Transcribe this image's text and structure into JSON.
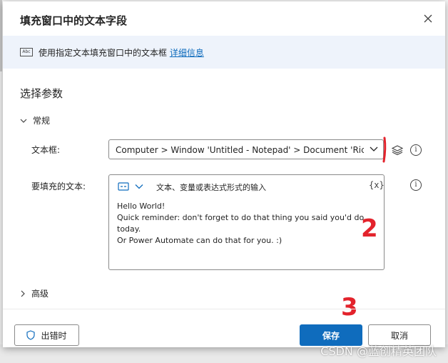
{
  "dialog": {
    "title": "填充窗口中的文本字段",
    "description": "使用指定文本填充窗口中的文本框",
    "more_info_link": "详细信息",
    "section_title": "选择参数"
  },
  "groups": {
    "general": "常规",
    "advanced": "高级"
  },
  "fields": {
    "textbox": {
      "label": "文本框:",
      "value": "Computer > Window 'Untitled - Notepad' > Document 'RichEdit"
    },
    "text_to_fill": {
      "label": "要填充的文本:",
      "hint": "文本、变量或表达式形式的输入",
      "variable_button": "{x}",
      "lines": [
        "Hello World!",
        "Quick reminder: don't forget to do that thing you said you'd do",
        "today.",
        "Or Power Automate can do that for you. :)"
      ]
    }
  },
  "footer": {
    "on_error_label": "出错时",
    "save_label": "保存",
    "cancel_label": "取消"
  },
  "annotations": {
    "mark_1": "1",
    "mark_2": "2",
    "mark_3": "3"
  },
  "watermark": "CSDN @蓝创精英团队",
  "colors": {
    "accent": "#0f6cbd",
    "banner_bg": "#eef3fb",
    "annotation_red": "#e3232c"
  },
  "icons": {
    "close": "close-icon",
    "abc": "text-field-icon",
    "chevron": "chevron-down-icon",
    "layers": "layers-icon",
    "info": "info-icon",
    "shield": "shield-icon"
  }
}
